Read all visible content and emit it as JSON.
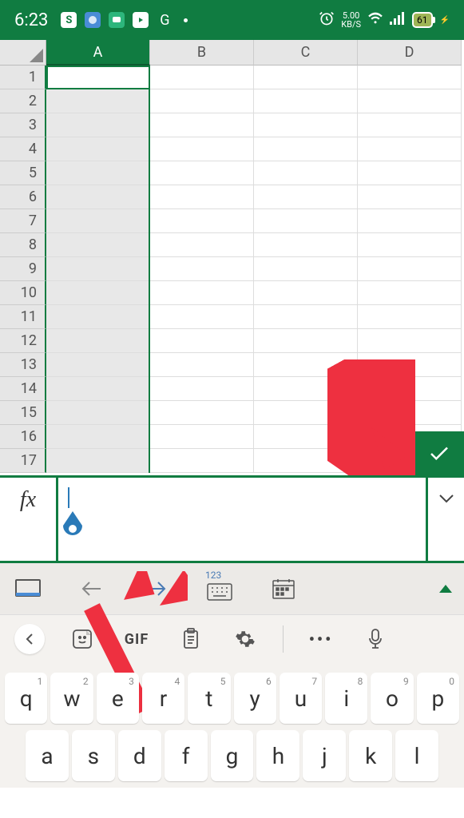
{
  "status": {
    "time": "6:23",
    "net_speed": "5.00",
    "net_unit": "KB/S",
    "battery": "61"
  },
  "columns": [
    "A",
    "B",
    "C",
    "D"
  ],
  "rows": [
    "1",
    "2",
    "3",
    "4",
    "5",
    "6",
    "7",
    "8",
    "9",
    "10",
    "11",
    "12",
    "13",
    "14",
    "15",
    "16",
    "17"
  ],
  "formula": {
    "fx": "fx",
    "value": ""
  },
  "toolbar": {
    "num_label": "123"
  },
  "kb_top": {
    "gif": "GIF"
  },
  "keyboard": {
    "row1": [
      {
        "k": "q",
        "n": "1"
      },
      {
        "k": "w",
        "n": "2"
      },
      {
        "k": "e",
        "n": "3"
      },
      {
        "k": "r",
        "n": "4"
      },
      {
        "k": "t",
        "n": "5"
      },
      {
        "k": "y",
        "n": "6"
      },
      {
        "k": "u",
        "n": "7"
      },
      {
        "k": "i",
        "n": "8"
      },
      {
        "k": "o",
        "n": "9"
      },
      {
        "k": "p",
        "n": "0"
      }
    ],
    "row2": [
      {
        "k": "a"
      },
      {
        "k": "s"
      },
      {
        "k": "d"
      },
      {
        "k": "f"
      },
      {
        "k": "g"
      },
      {
        "k": "h"
      },
      {
        "k": "j"
      },
      {
        "k": "k"
      },
      {
        "k": "l"
      }
    ]
  }
}
